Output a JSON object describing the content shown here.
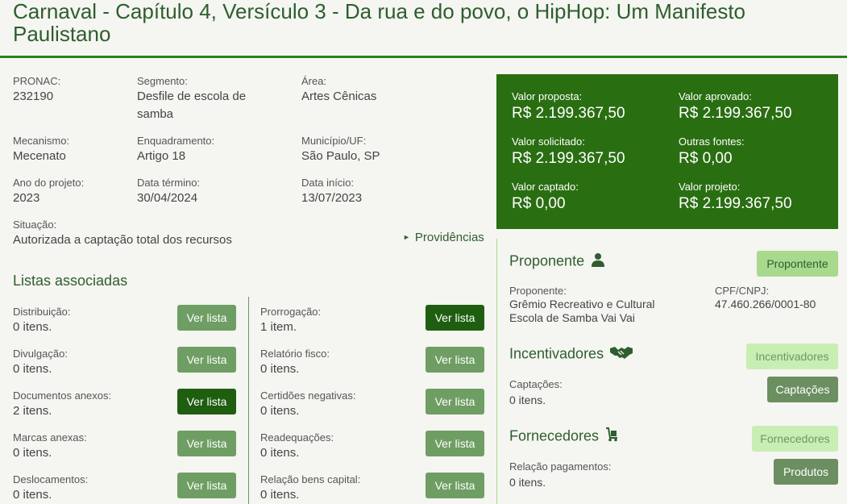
{
  "title": "Carnaval - Capítulo 4, Versículo 3 - Da rua e do povo, o HipHop: Um Manifesto Paulistano",
  "details": {
    "pronac": {
      "label": "PRONAC:",
      "value": "232190"
    },
    "segmento": {
      "label": "Segmento:",
      "value": "Desfile de escola de samba"
    },
    "area": {
      "label": "Área:",
      "value": "Artes Cênicas"
    },
    "mecanismo": {
      "label": "Mecanismo:",
      "value": "Mecenato"
    },
    "enquadramento": {
      "label": "Enquadramento:",
      "value": "Artigo 18"
    },
    "municipio": {
      "label": "Município/UF:",
      "value": "São Paulo, SP"
    },
    "ano": {
      "label": "Ano do projeto:",
      "value": "2023"
    },
    "data_termino": {
      "label": "Data término:",
      "value": "30/04/2024"
    },
    "data_inicio": {
      "label": "Data início:",
      "value": "13/07/2023"
    },
    "situacao": {
      "label": "Situação:",
      "value": "Autorizada a captação total dos recursos"
    }
  },
  "providencias_label": "Providências",
  "values": {
    "proposta": {
      "label": "Valor proposta:",
      "value": "R$ 2.199.367,50"
    },
    "aprovado": {
      "label": "Valor aprovado:",
      "value": "R$ 2.199.367,50"
    },
    "solicitado": {
      "label": "Valor solicitado:",
      "value": "R$ 2.199.367,50"
    },
    "outras": {
      "label": "Outras fontes:",
      "value": "R$ 0,00"
    },
    "captado": {
      "label": "Valor captado:",
      "value": "R$ 0,00"
    },
    "projeto": {
      "label": "Valor projeto:",
      "value": "R$ 2.199.367,50"
    }
  },
  "listas": {
    "title": "Listas associadas",
    "button_label": "Ver lista",
    "left": [
      {
        "label": "Distribuição:",
        "value": "0 itens."
      },
      {
        "label": "Divulgação:",
        "value": "0 itens."
      },
      {
        "label": "Documentos anexos:",
        "value": "2 itens."
      },
      {
        "label": "Marcas anexas:",
        "value": "0 itens."
      },
      {
        "label": "Deslocamentos:",
        "value": "0 itens."
      }
    ],
    "right": [
      {
        "label": "Prorrogação:",
        "value": "1 item."
      },
      {
        "label": "Relatório fisco:",
        "value": "0 itens."
      },
      {
        "label": "Certidões negativas:",
        "value": "0 itens."
      },
      {
        "label": "Readequações:",
        "value": "0 itens."
      },
      {
        "label": "Relação bens capital:",
        "value": "0 itens."
      }
    ]
  },
  "proponente": {
    "title": "Proponente",
    "button": "Propontente",
    "name_label": "Proponente:",
    "name_value": "Grêmio Recreativo e Cultural Escola de Samba Vai Vai",
    "doc_label": "CPF/CNPJ:",
    "doc_value": "47.460.266/0001-80"
  },
  "incentivadores": {
    "title": "Incentivadores",
    "button": "Incentivadores",
    "captacoes_label": "Captações:",
    "captacoes_value": "0 itens.",
    "captacoes_button": "Captações"
  },
  "fornecedores": {
    "title": "Fornecedores",
    "button": "Fornecedores",
    "pagamentos_label": "Relação pagamentos:",
    "pagamentos_value": "0 itens.",
    "produtos_button": "Produtos"
  },
  "colors": {
    "primary": "#2a6e12",
    "button_light": "#6e9e63",
    "button_dark": "#1f5e10",
    "button_pale": "#a9d98c",
    "heading": "#2e5e2e"
  }
}
